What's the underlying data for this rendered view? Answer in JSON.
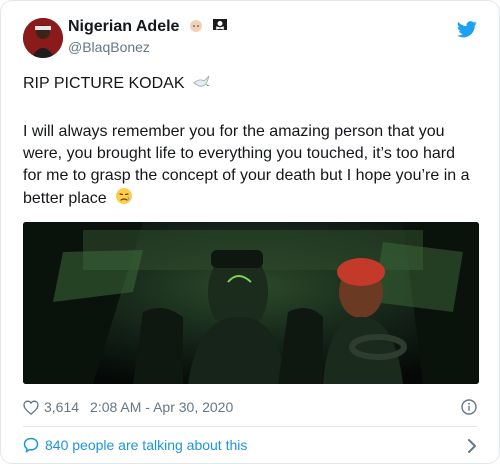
{
  "user": {
    "display_name": "Nigerian Adele",
    "handle": "@BlaqBonez"
  },
  "tweet": {
    "title_line": "RIP PICTURE KODAK",
    "body": "I will always remember you for the amazing person that you were, you brought life to everything you touched, it’s too hard for me to grasp the concept of your death but I hope you’re in a better place"
  },
  "meta": {
    "likes": "3,614",
    "timestamp": "2:08 AM - Apr 30, 2020"
  },
  "footer": {
    "talking": "840 people are talking about this"
  },
  "icons": {
    "brand": "twitter-bird-icon",
    "like": "heart-icon",
    "info": "info-icon",
    "comment": "speech-bubble-icon",
    "chevron": "chevron-right-icon"
  },
  "colors": {
    "accent": "#1b95e0",
    "muted": "#657786"
  }
}
